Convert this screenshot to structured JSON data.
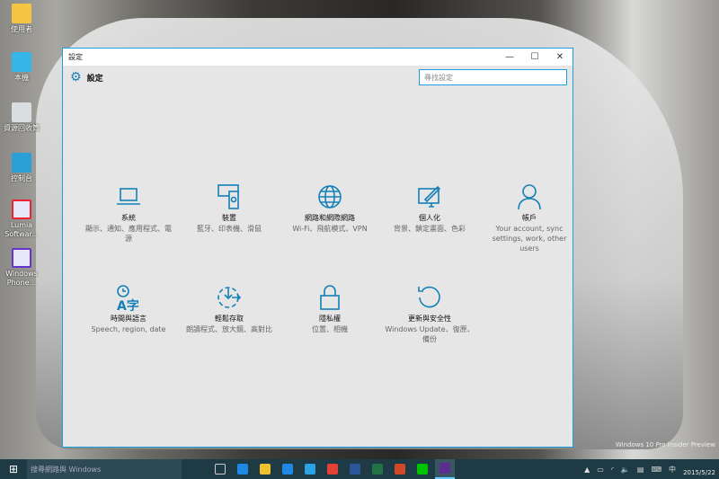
{
  "desktop": {
    "icons": [
      "使用者",
      "本機",
      "資源回收筒",
      "控制台",
      "Lumia Softwar...",
      "Windows Phone..."
    ]
  },
  "window": {
    "title": "設定",
    "minimize": "—",
    "maximize": "☐",
    "close": "✕"
  },
  "header": {
    "title": "設定",
    "search_placeholder": "尋找設定"
  },
  "tiles": [
    {
      "name": "系統",
      "desc": "顯示、通知、應用程式、電源",
      "icon": "laptop-icon"
    },
    {
      "name": "裝置",
      "desc": "藍牙、印表機、滑鼠",
      "icon": "devices-icon"
    },
    {
      "name": "網路和網際網路",
      "desc": "Wi-Fi、飛航模式、VPN",
      "icon": "globe-icon"
    },
    {
      "name": "個人化",
      "desc": "背景、鎖定畫面、色彩",
      "icon": "paint-icon"
    },
    {
      "name": "帳戶",
      "desc": "Your account, sync settings, work, other users",
      "icon": "person-icon"
    },
    {
      "name": "時間與語言",
      "desc": "Speech, region, date",
      "icon": "time-language-icon"
    },
    {
      "name": "輕鬆存取",
      "desc": "朗讀程式、放大鏡、高對比",
      "icon": "ease-of-access-icon"
    },
    {
      "name": "隱私權",
      "desc": "位置、相機",
      "icon": "lock-icon"
    },
    {
      "name": "更新與安全性",
      "desc": "Windows Update、復原、備份",
      "icon": "update-icon"
    }
  ],
  "taskbar": {
    "search_placeholder": "搜尋網路與 Windows",
    "ime": "中",
    "date": "2015/5/22",
    "apps": [
      {
        "name": "task-view",
        "color": "#1e3a44"
      },
      {
        "name": "internet-explorer-edge",
        "color": "#1e88e5"
      },
      {
        "name": "file-explorer",
        "color": "#f2c12e"
      },
      {
        "name": "store",
        "color": "#1e88e5"
      },
      {
        "name": "internet-explorer",
        "color": "#2aa2e6"
      },
      {
        "name": "chrome",
        "color": "#e44134"
      },
      {
        "name": "word",
        "color": "#2b579a"
      },
      {
        "name": "excel",
        "color": "#217346"
      },
      {
        "name": "powerpoint",
        "color": "#d24726"
      },
      {
        "name": "line",
        "color": "#00c300"
      },
      {
        "name": "settings",
        "color": "#5c2d91"
      }
    ]
  },
  "watermark": "Windows 10 Pro Insider Preview"
}
